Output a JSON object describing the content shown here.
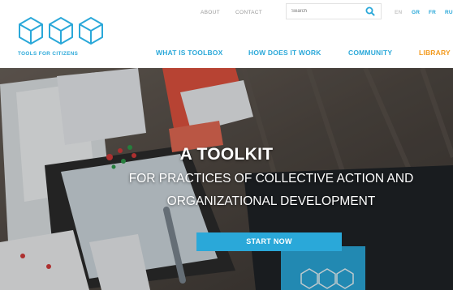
{
  "logo": {
    "text": "TOOLS FOR CITIZENS"
  },
  "utility_nav": [
    {
      "label": "ABOUT"
    },
    {
      "label": "CONTACT"
    }
  ],
  "search": {
    "placeholder": "Search"
  },
  "languages": [
    {
      "label": "EN",
      "color": "#c8c8c8"
    },
    {
      "label": "GR",
      "color": "#2aa8d9"
    },
    {
      "label": "FR",
      "color": "#2aa8d9"
    },
    {
      "label": "RU",
      "color": "#2aa8d9"
    }
  ],
  "main_nav": [
    {
      "label": "WHAT IS TOOLBOX",
      "color": "#2aa8d9"
    },
    {
      "label": "HOW DOES IT WORK",
      "color": "#2aa8d9"
    },
    {
      "label": "COMMUNITY",
      "color": "#2aa8d9"
    },
    {
      "label": "LIBRARY",
      "color": "#f39a1d"
    }
  ],
  "hero": {
    "title": "A TOOLKIT",
    "subtitle_line1": "FOR PRACTICES OF COLLECTIVE ACTION AND",
    "subtitle_line2": "ORGANIZATIONAL DEVELOPMENT",
    "cta": "START NOW"
  },
  "colors": {
    "brand_blue": "#2aa8d9",
    "library_orange": "#f39a1d"
  }
}
